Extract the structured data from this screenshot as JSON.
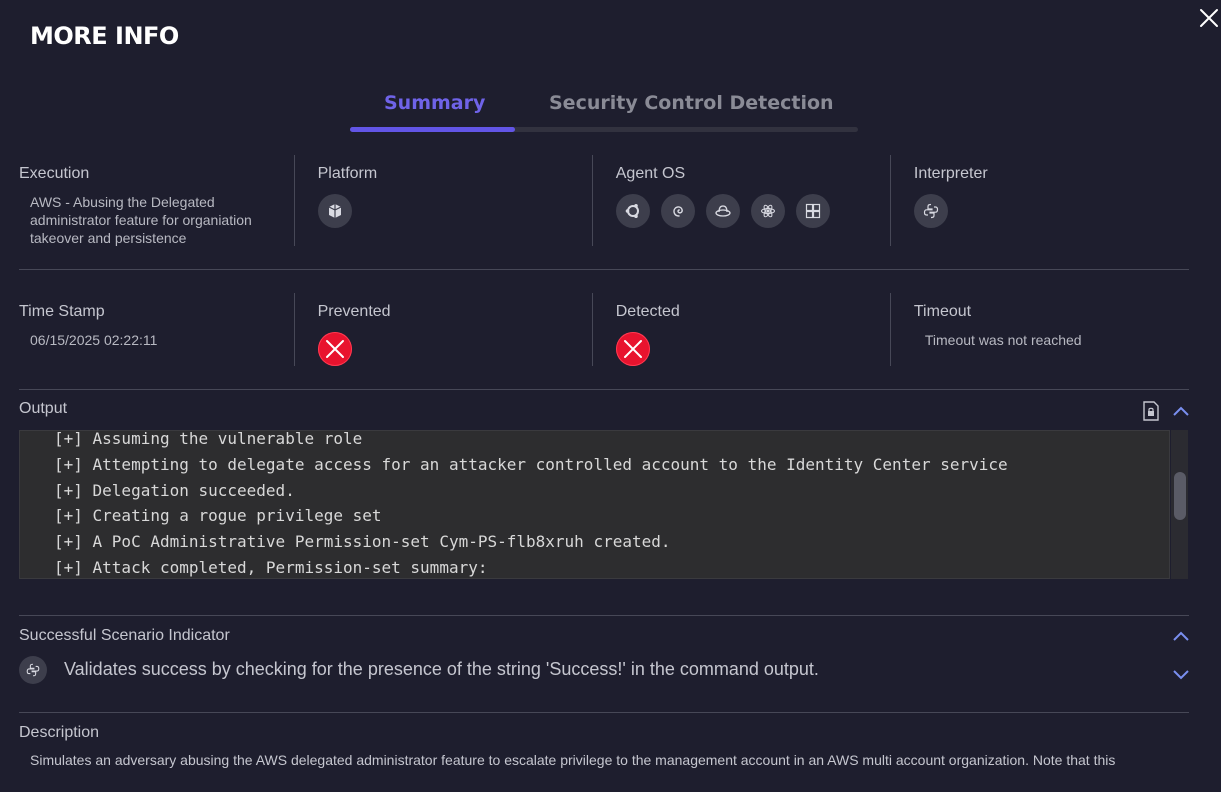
{
  "modal": {
    "title": "MORE INFO"
  },
  "tabs": [
    {
      "label": "Summary",
      "active": true
    },
    {
      "label": "Security Control Detection",
      "active": false
    }
  ],
  "info_row1": {
    "execution": {
      "label": "Execution",
      "value_lines": [
        "AWS - Abusing the Delegated",
        "administrator feature for organiation",
        "takeover and persistence"
      ]
    },
    "platform": {
      "label": "Platform",
      "icons": [
        "aws-cube-icon"
      ]
    },
    "agent_os": {
      "label": "Agent OS",
      "icons": [
        "ubuntu-icon",
        "debian-icon",
        "redhat-icon",
        "macos-icon",
        "windows-icon"
      ]
    },
    "interpreter": {
      "label": "Interpreter",
      "icons": [
        "python-icon"
      ]
    }
  },
  "info_row2": {
    "timestamp": {
      "label": "Time Stamp",
      "value": "06/15/2025 02:22:11"
    },
    "prevented": {
      "label": "Prevented",
      "status": "no"
    },
    "detected": {
      "label": "Detected",
      "status": "no"
    },
    "timeout": {
      "label": "Timeout",
      "value": "Timeout was not reached"
    }
  },
  "output": {
    "label": "Output",
    "lines": [
      "[+] Assuming the vulnerable role",
      "[+] Attempting to delegate access for an attacker controlled account to the Identity Center service",
      "[+] Delegation succeeded.",
      "[+] Creating a rogue privilege set",
      "[+] A PoC Administrative Permission-set Cym-PS-flb8xruh created.",
      "[+] Attack completed, Permission-set summary:"
    ]
  },
  "indicator": {
    "label": "Successful Scenario Indicator",
    "text": "Validates success by checking for the presence of the string 'Success!' in the command output."
  },
  "description": {
    "label": "Description",
    "text": "Simulates an adversary abusing the AWS delegated administrator feature to escalate privilege to the management account in an AWS multi account organization. Note that this"
  },
  "colors": {
    "background": "#1e1e2e",
    "accent": "#6255e6",
    "danger": "#e8132e"
  }
}
